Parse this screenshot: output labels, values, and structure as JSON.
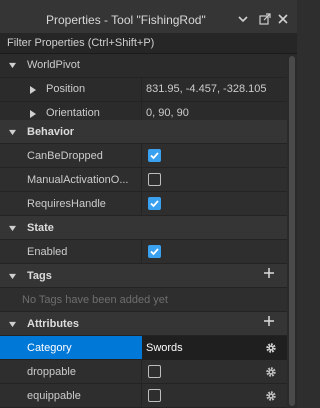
{
  "window": {
    "title": "Properties - Tool \"FishingRod\"",
    "icons": [
      "chevron-down-icon",
      "undock-icon",
      "close-icon"
    ]
  },
  "filter": {
    "placeholder": "Filter Properties (Ctrl+Shift+P)"
  },
  "sections": {
    "world_pivot": {
      "label": "WorldPivot",
      "position": {
        "label": "Position",
        "value": "831.95, -4.457, -328.105"
      },
      "orientation": {
        "label": "Orientation",
        "value": "0, 90, 90"
      }
    },
    "behavior": {
      "label": "Behavior",
      "properties": [
        {
          "label": "CanBeDropped",
          "checked": true
        },
        {
          "label": "ManualActivationO...",
          "checked": false
        },
        {
          "label": "RequiresHandle",
          "checked": true
        }
      ]
    },
    "state": {
      "label": "State",
      "properties": [
        {
          "label": "Enabled",
          "checked": true
        }
      ]
    },
    "tags": {
      "label": "Tags",
      "empty_message": "No Tags have been added yet"
    },
    "attributes": {
      "label": "Attributes",
      "items": [
        {
          "label": "Category",
          "value": "Swords",
          "selected": true
        },
        {
          "label": "droppable",
          "checked": false
        },
        {
          "label": "equippable",
          "checked": false
        }
      ]
    }
  },
  "colors": {
    "accent": "#0078d7",
    "checkbox_on": "#3aa0f0",
    "background": "#2e2e2e"
  }
}
